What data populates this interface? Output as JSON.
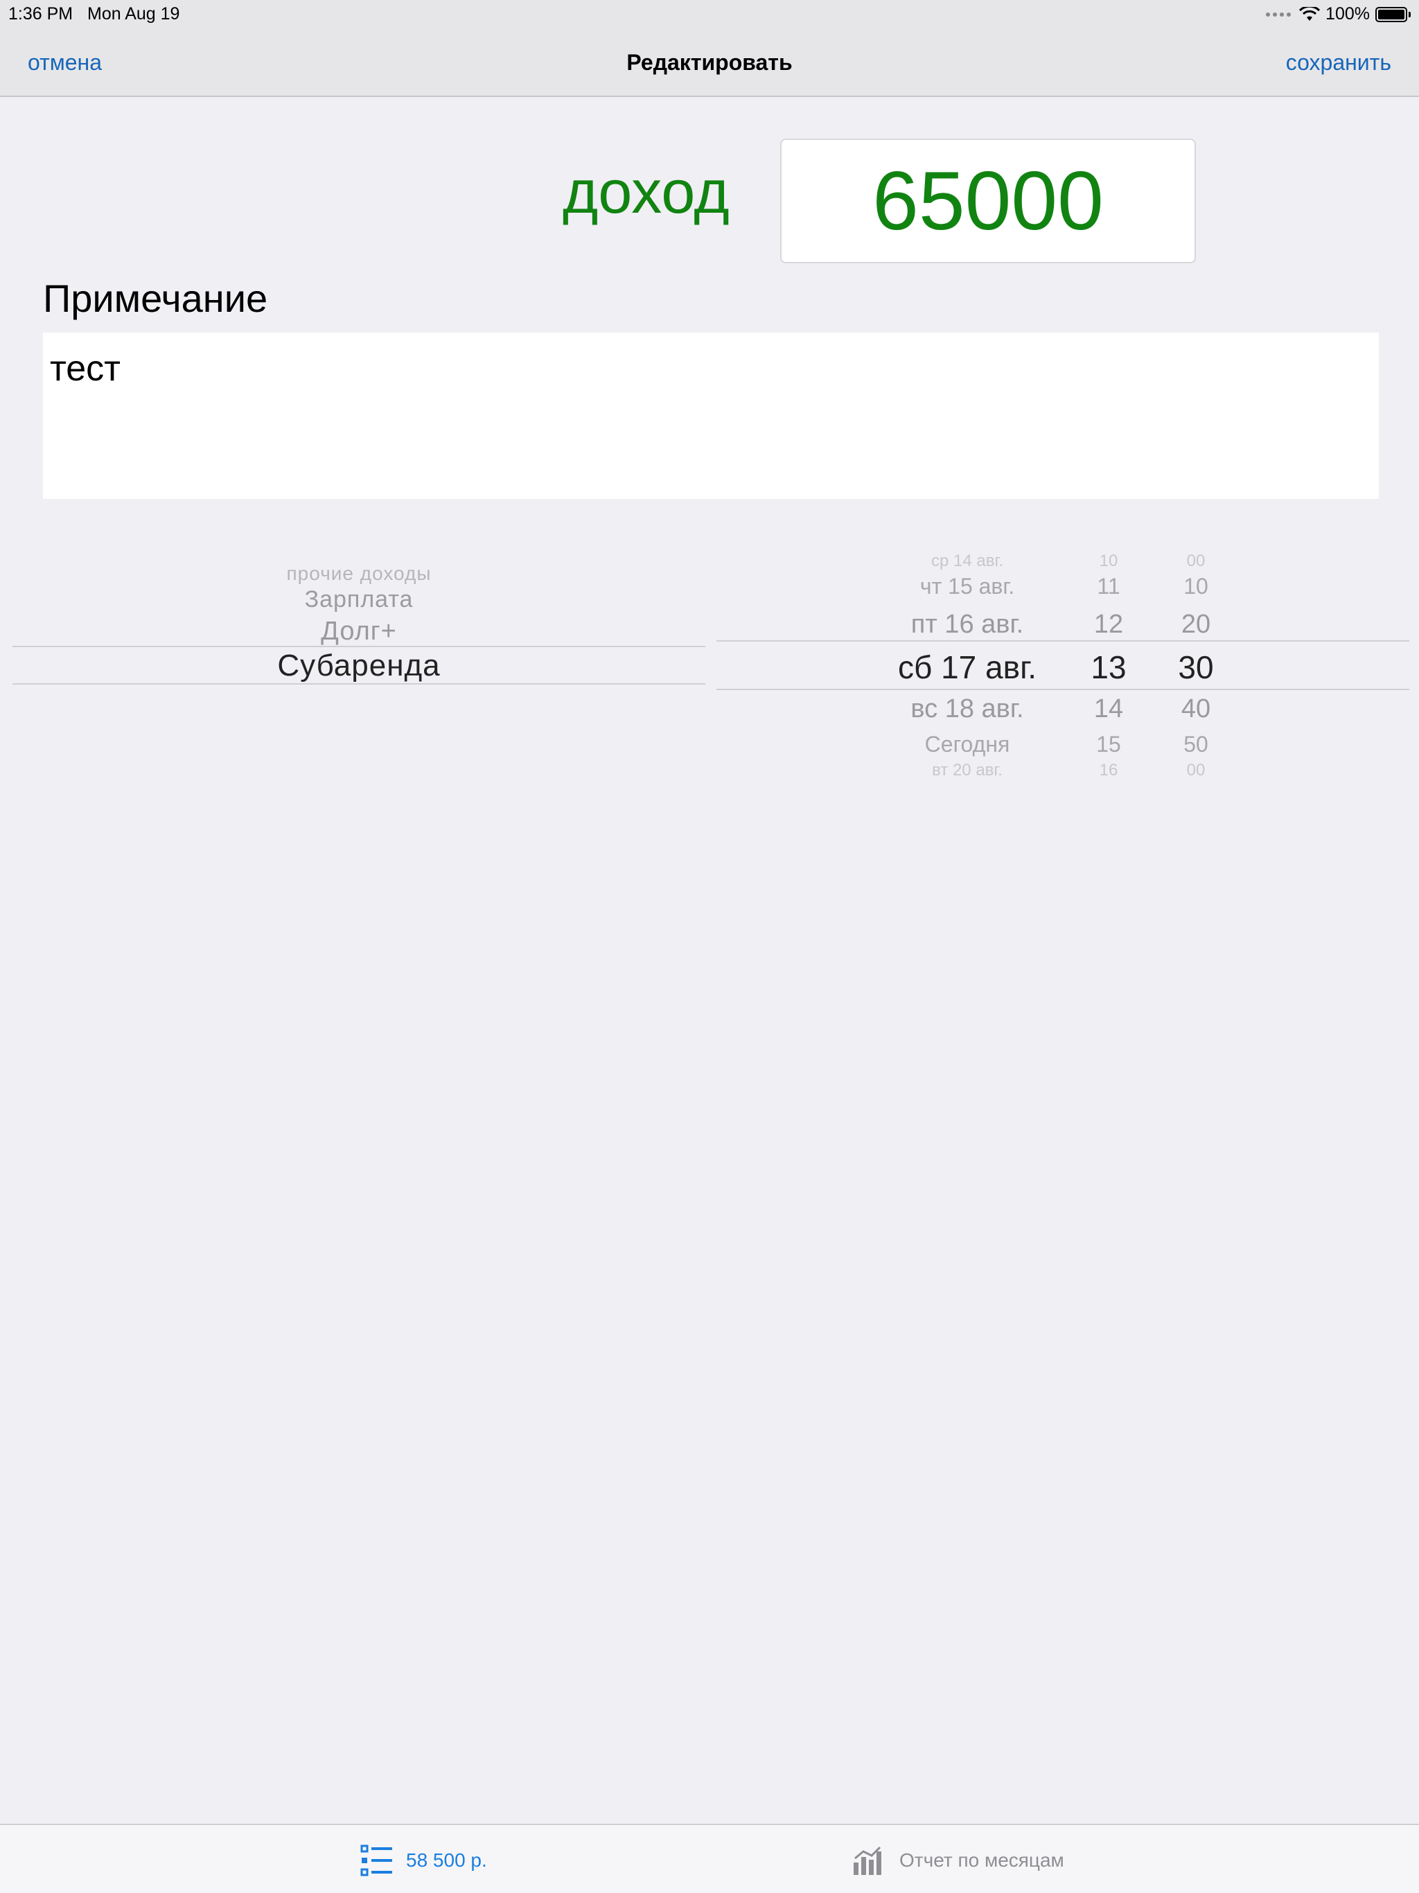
{
  "status_bar": {
    "time": "1:36 PM",
    "date": "Mon Aug 19",
    "battery": "100%"
  },
  "nav": {
    "cancel": "отмена",
    "title": "Редактировать",
    "save": "сохранить"
  },
  "entry": {
    "type_label": "доход",
    "amount": "65000",
    "amount_color": "#118311"
  },
  "note": {
    "label": "Примечание",
    "value": "тест"
  },
  "category_picker": {
    "items": [
      "прочие доходы",
      "Зарплата",
      "Долг+",
      "Субаренда"
    ],
    "selected": "Субаренда"
  },
  "datetime_picker": {
    "rows": [
      {
        "date": "ср 14 авг.",
        "hour": "10",
        "minute": "00"
      },
      {
        "date": "чт 15 авг.",
        "hour": "11",
        "minute": "10"
      },
      {
        "date": "пт 16 авг.",
        "hour": "12",
        "minute": "20"
      },
      {
        "date": "сб 17 авг.",
        "hour": "13",
        "minute": "30"
      },
      {
        "date": "вс 18 авг.",
        "hour": "14",
        "minute": "40"
      },
      {
        "date": "Сегодня",
        "hour": "15",
        "minute": "50"
      },
      {
        "date": "вт 20 авг.",
        "hour": "16",
        "minute": "00"
      }
    ],
    "selected_index": 3
  },
  "tab_bar": {
    "tabs": [
      {
        "label": "58 500 р.",
        "icon": "list-icon"
      },
      {
        "label": "Отчет по месяцам",
        "icon": "bar-chart-icon"
      }
    ],
    "accent": "#1b7ee0"
  }
}
